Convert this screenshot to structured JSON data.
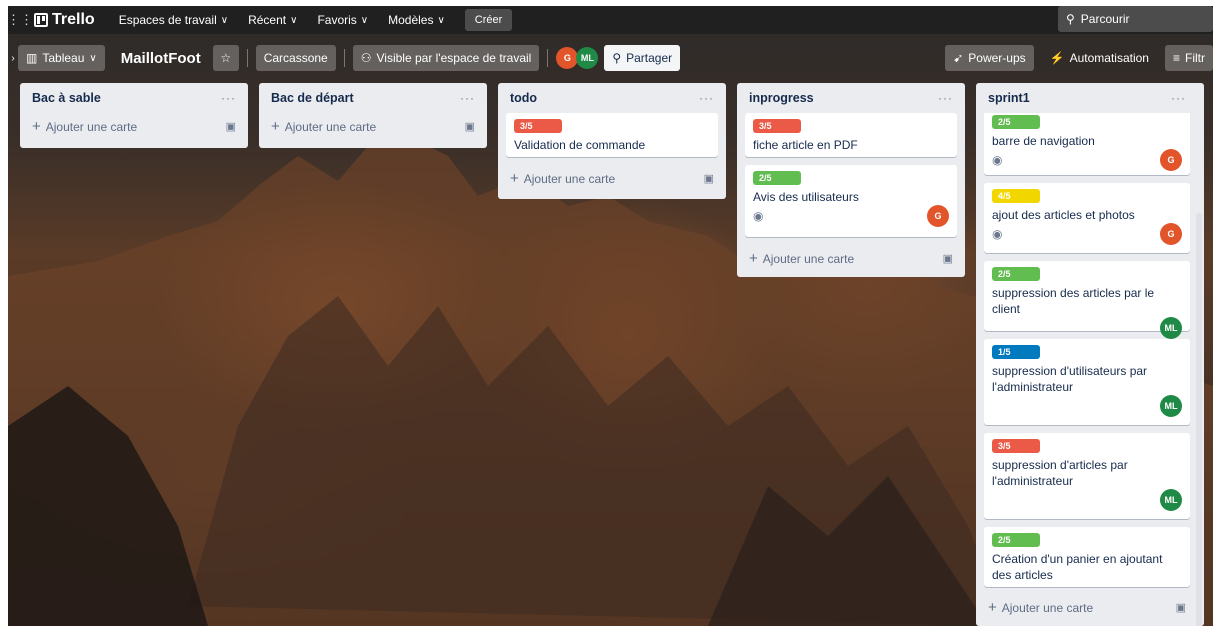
{
  "topbar": {
    "app_name": "Trello",
    "nav": [
      "Espaces de travail",
      "Récent",
      "Favoris",
      "Modèles"
    ],
    "create_label": "Créer",
    "search_placeholder": "Parcourir"
  },
  "boardbar": {
    "view_label": "Tableau",
    "board_title": "MaillotFoot",
    "workspace": "Carcassone",
    "visibility": "Visible par l'espace de travail",
    "members": [
      "G",
      "ML"
    ],
    "share_label": "Partager",
    "powerups_label": "Power-ups",
    "automation_label": "Automatisation",
    "filter_label": "Filtr"
  },
  "add_card_label": "Ajouter une carte",
  "colors": {
    "red": "#eb5a46",
    "green": "#61bd4f",
    "yellow": "#f2d600",
    "blue": "#0079bf",
    "avatar_g": "#e2552b",
    "avatar_ml": "#1f8a46"
  },
  "lists": [
    {
      "title": "Bac à sable",
      "cards": []
    },
    {
      "title": "Bac de départ",
      "cards": []
    },
    {
      "title": "todo",
      "cards": [
        {
          "label": "3/5",
          "title": "Validation de commande"
        }
      ]
    },
    {
      "title": "inprogress",
      "cards": [
        {
          "label": "3/5",
          "title": "fiche article en PDF"
        },
        {
          "label": "2/5",
          "title": "Avis des utilisateurs",
          "member": "G"
        }
      ]
    },
    {
      "title": "sprint1",
      "cards": [
        {
          "label": "2/5",
          "title": "barre de navigation",
          "member": "G"
        },
        {
          "label": "4/5",
          "title": "ajout des articles et photos",
          "member": "G"
        },
        {
          "label": "2/5",
          "title": "suppression des articles par le client",
          "member": "ML"
        },
        {
          "label": "1/5",
          "title": "suppression d'utilisateurs par l'administrateur",
          "member": "ML"
        },
        {
          "label": "3/5",
          "title": "suppression d'articles par l'administrateur",
          "member": "ML"
        },
        {
          "label": "2/5",
          "title": "Création d'un panier en ajoutant des articles"
        }
      ]
    }
  ]
}
